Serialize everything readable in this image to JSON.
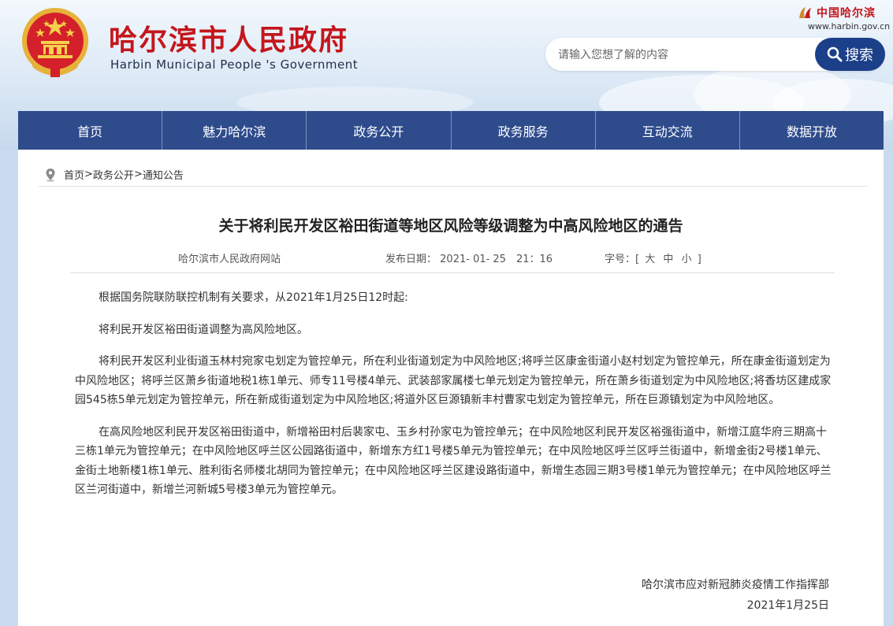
{
  "header": {
    "site_title": "哈尔滨市人民政府",
    "site_subtitle": "Harbin Municipal People 's Government",
    "brand_text": "中国哈尔滨",
    "brand_url": "www.harbin.gov.cn"
  },
  "search": {
    "placeholder": "请输入您想了解的内容",
    "button_label": "搜索"
  },
  "nav": {
    "items": [
      {
        "label": "首页"
      },
      {
        "label": "魅力哈尔滨"
      },
      {
        "label": "政务公开"
      },
      {
        "label": "政务服务"
      },
      {
        "label": "互动交流"
      },
      {
        "label": "数据开放"
      }
    ]
  },
  "breadcrumb": {
    "items": [
      "首页",
      "政务公开",
      "通知公告"
    ],
    "separator": ">"
  },
  "article": {
    "title": "关于将利民开发区裕田街道等地区风险等级调整为中高风险地区的通告",
    "source": "哈尔滨市人民政府网站",
    "publish_label": "发布日期：",
    "publish_date": "2021- 01- 25　21：16",
    "font_size_label": "字号：[",
    "font_sizes": [
      "大",
      "中",
      "小"
    ],
    "font_size_close": "]",
    "paragraphs": [
      "根据国务院联防联控机制有关要求，从2021年1月25日12时起:",
      "将利民开发区裕田街道调整为高风险地区。",
      "将利民开发区利业街道玉林村宛家屯划定为管控单元，所在利业街道划定为中风险地区;将呼兰区康金街道小赵村划定为管控单元，所在康金街道划定为中风险地区；将呼兰区萧乡街道地税1栋1单元、师专11号楼4单元、武装部家属楼七单元划定为管控单元，所在萧乡街道划定为中风险地区;将香坊区建成家园545栋5单元划定为管控单元，所在新成街道划定为中风险地区;将道外区巨源镇新丰村曹家屯划定为管控单元，所在巨源镇划定为中风险地区。",
      "在高风险地区利民开发区裕田街道中，新增裕田村后裴家屯、玉乡村孙家屯为管控单元；在中风险地区利民开发区裕强街道中，新增江庭华府三期高十三栋1单元为管控单元；在中风险地区呼兰区公园路街道中，新增东方红1号楼5单元为管控单元；在中风险地区呼兰区呼兰街道中，新增金街2号楼1单元、金街土地新楼1栋1单元、胜利街名师楼北胡同为管控单元；在中风险地区呼兰区建设路街道中，新增生态园三期3号楼1单元为管控单元；在中风险地区呼兰区兰河街道中，新增兰河新城5号楼3单元为管控单元。"
    ],
    "signature_org": "哈尔滨市应对新冠肺炎疫情工作指挥部",
    "signature_date": "2021年1月25日"
  },
  "colors": {
    "title_red": "#c4161c",
    "nav_blue": "#2e4b8c",
    "search_button": "#1c3f8a"
  }
}
